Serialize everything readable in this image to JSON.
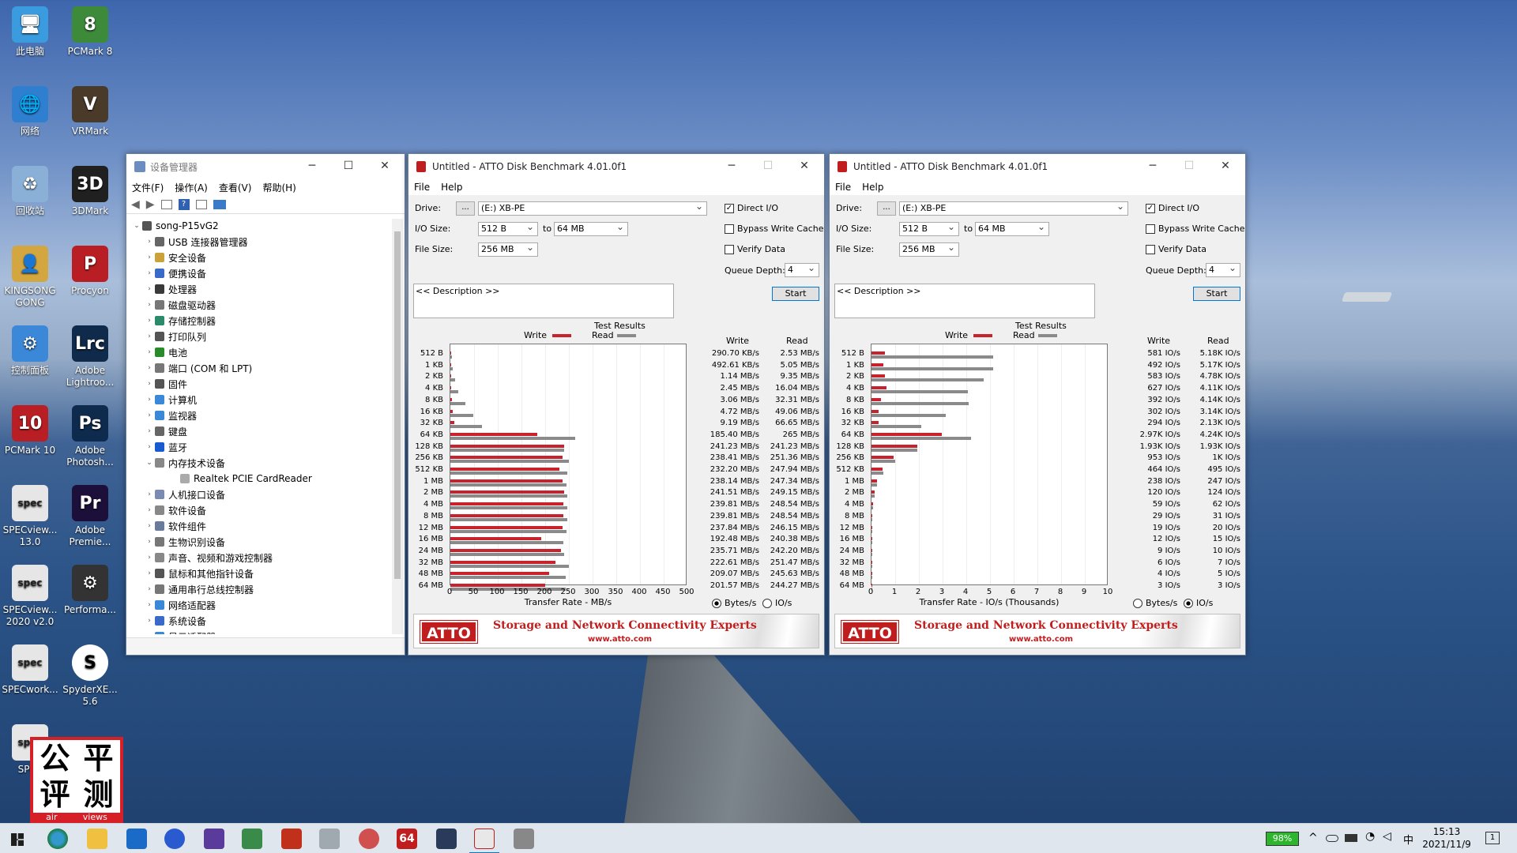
{
  "desktop": {
    "icons": [
      {
        "label": "此电脑",
        "color": "#3b9bdf",
        "glyph": "🖥"
      },
      {
        "label": "PCMark 8",
        "color": "#3c8a3a",
        "glyph": "8"
      },
      {
        "label": "网络",
        "color": "#2e7fd0",
        "glyph": "🌐"
      },
      {
        "label": "VRMark",
        "color": "#4a3a2a",
        "glyph": "V"
      },
      {
        "label": "回收站",
        "color": "#8ab0d8",
        "glyph": "♻"
      },
      {
        "label": "3DMark",
        "color": "#202020",
        "glyph": "3D"
      },
      {
        "label": "KINGSONG GONG",
        "color": "#d4a640",
        "glyph": "👤"
      },
      {
        "label": "Procyon",
        "color": "#b81e24",
        "glyph": "P"
      },
      {
        "label": "控制面板",
        "color": "#3b88d8",
        "glyph": "⚙"
      },
      {
        "label": "Adobe Lightroo...",
        "color": "#0f2a4a",
        "glyph": "Lrc"
      },
      {
        "label": "PCMark 10",
        "color": "#b81e24",
        "glyph": "10"
      },
      {
        "label": "Adobe Photosh...",
        "color": "#0e2a4d",
        "glyph": "Ps"
      },
      {
        "label": "SPECview... 13.0",
        "color": "#7a7a7a",
        "glyph": "spec"
      },
      {
        "label": "Adobe Premie...",
        "color": "#1c0f3a",
        "glyph": "Pr"
      },
      {
        "label": "SPECview... 2020 v2.0",
        "color": "#7a7a7a",
        "glyph": "spec"
      },
      {
        "label": "Performa...",
        "color": "#333333",
        "glyph": "⚙"
      },
      {
        "label": "SPECwork...",
        "color": "#7a7a7a",
        "glyph": "spec"
      },
      {
        "label": "SpyderXE... 5.6",
        "color": "#ffffff",
        "glyph": "S"
      },
      {
        "label": "SPEC",
        "color": "#7a7a7a",
        "glyph": "spec"
      }
    ],
    "watermark": {
      "chars": [
        "公",
        "平",
        "评",
        "测"
      ],
      "sub_left": "air",
      "sub_right": "views"
    }
  },
  "devmgr": {
    "title": "设备管理器",
    "menu": [
      "文件(F)",
      "操作(A)",
      "查看(V)",
      "帮助(H)"
    ],
    "root": "song-P15vG2",
    "items": [
      "USB 连接器管理器",
      "安全设备",
      "便携设备",
      "处理器",
      "磁盘驱动器",
      "存储控制器",
      "打印队列",
      "电池",
      "端口 (COM 和 LPT)",
      "固件",
      "计算机",
      "监视器",
      "键盘",
      "蓝牙",
      "内存技术设备",
      "Realtek PCIE CardReader",
      "人机接口设备",
      "软件设备",
      "软件组件",
      "生物识别设备",
      "声音、视频和游戏控制器",
      "鼠标和其他指针设备",
      "通用串行总线控制器",
      "网络适配器",
      "系统设备",
      "显示适配器"
    ]
  },
  "atto_common": {
    "menu_file": "File",
    "menu_help": "Help",
    "drive_label": "Drive:",
    "drive_btn": "...",
    "drive_value": "(E:) XB-PE",
    "io_label": "I/O Size:",
    "io_from": "512 B",
    "io_to_label": "to",
    "io_to": "64 MB",
    "file_label": "File Size:",
    "file_value": "256 MB",
    "direct_io": "Direct I/O",
    "bypass": "Bypass Write Cache",
    "verify": "Verify Data",
    "qd_label": "Queue Depth:",
    "qd_value": "4",
    "desc": "<< Description >>",
    "start": "Start",
    "results_title": "Test Results",
    "legend_write": "Write",
    "legend_read": "Read",
    "col_write": "Write",
    "col_read": "Read",
    "radio_bytes": "Bytes/s",
    "radio_io": "IO/s",
    "banner_logo": "ATTO",
    "banner_text": "Storage and Network Connectivity Experts",
    "banner_url": "www.atto.com",
    "sizes": [
      "512 B",
      "1 KB",
      "2 KB",
      "4 KB",
      "8 KB",
      "16 KB",
      "32 KB",
      "64 KB",
      "128 KB",
      "256 KB",
      "512 KB",
      "1 MB",
      "2 MB",
      "4 MB",
      "8 MB",
      "12 MB",
      "16 MB",
      "24 MB",
      "32 MB",
      "48 MB",
      "64 MB"
    ]
  },
  "atto1": {
    "title": "Untitled - ATTO Disk Benchmark 4.01.0f1",
    "xlabel": "Transfer Rate - MB/s",
    "ticks": [
      "0",
      "50",
      "100",
      "150",
      "200",
      "250",
      "300",
      "350",
      "400",
      "450",
      "500"
    ],
    "max": 500,
    "unit_selected": "bytes",
    "write_vals": [
      "290.70 KB/s",
      "492.61 KB/s",
      "1.14 MB/s",
      "2.45 MB/s",
      "3.06 MB/s",
      "4.72 MB/s",
      "9.19 MB/s",
      "185.40 MB/s",
      "241.23 MB/s",
      "238.41 MB/s",
      "232.20 MB/s",
      "238.14 MB/s",
      "241.51 MB/s",
      "239.81 MB/s",
      "239.81 MB/s",
      "237.84 MB/s",
      "192.48 MB/s",
      "235.71 MB/s",
      "222.61 MB/s",
      "209.07 MB/s",
      "201.57 MB/s"
    ],
    "read_vals": [
      "2.53 MB/s",
      "5.05 MB/s",
      "9.35 MB/s",
      "16.04 MB/s",
      "32.31 MB/s",
      "49.06 MB/s",
      "66.65 MB/s",
      "265 MB/s",
      "241.23 MB/s",
      "251.36 MB/s",
      "247.94 MB/s",
      "247.34 MB/s",
      "249.15 MB/s",
      "248.54 MB/s",
      "248.54 MB/s",
      "246.15 MB/s",
      "240.38 MB/s",
      "242.20 MB/s",
      "251.47 MB/s",
      "245.63 MB/s",
      "244.27 MB/s"
    ],
    "write": [
      0.28,
      0.48,
      1.14,
      2.45,
      3.06,
      4.72,
      9.19,
      185.4,
      241.23,
      238.41,
      232.2,
      238.14,
      241.51,
      239.81,
      239.81,
      237.84,
      192.48,
      235.71,
      222.61,
      209.07,
      201.57
    ],
    "read": [
      2.53,
      5.05,
      9.35,
      16.04,
      32.31,
      49.06,
      66.65,
      265,
      241.23,
      251.36,
      247.94,
      247.34,
      249.15,
      248.54,
      248.54,
      246.15,
      240.38,
      242.2,
      251.47,
      245.63,
      244.27
    ]
  },
  "atto2": {
    "title": "Untitled - ATTO Disk Benchmark 4.01.0f1",
    "xlabel": "Transfer Rate - IO/s (Thousands)",
    "ticks": [
      "0",
      "1",
      "2",
      "3",
      "4",
      "5",
      "6",
      "7",
      "8",
      "9",
      "10"
    ],
    "max": 10,
    "unit_selected": "io",
    "write_vals": [
      "581 IO/s",
      "492 IO/s",
      "583 IO/s",
      "627 IO/s",
      "392 IO/s",
      "302 IO/s",
      "294 IO/s",
      "2.97K IO/s",
      "1.93K IO/s",
      "953 IO/s",
      "464 IO/s",
      "238 IO/s",
      "120 IO/s",
      "59 IO/s",
      "29 IO/s",
      "19 IO/s",
      "12 IO/s",
      "9 IO/s",
      "6 IO/s",
      "4 IO/s",
      "3 IO/s"
    ],
    "read_vals": [
      "5.18K IO/s",
      "5.17K IO/s",
      "4.78K IO/s",
      "4.11K IO/s",
      "4.14K IO/s",
      "3.14K IO/s",
      "2.13K IO/s",
      "4.24K IO/s",
      "1.93K IO/s",
      "1K IO/s",
      "495 IO/s",
      "247 IO/s",
      "124 IO/s",
      "62 IO/s",
      "31 IO/s",
      "20 IO/s",
      "15 IO/s",
      "10 IO/s",
      "7 IO/s",
      "5 IO/s",
      "3 IO/s"
    ],
    "write": [
      0.581,
      0.492,
      0.583,
      0.627,
      0.392,
      0.302,
      0.294,
      2.97,
      1.93,
      0.953,
      0.464,
      0.238,
      0.12,
      0.059,
      0.029,
      0.019,
      0.012,
      0.009,
      0.006,
      0.004,
      0.003
    ],
    "read": [
      5.18,
      5.17,
      4.78,
      4.11,
      4.14,
      3.14,
      2.13,
      4.24,
      1.93,
      1.0,
      0.495,
      0.247,
      0.124,
      0.062,
      0.031,
      0.02,
      0.015,
      0.01,
      0.007,
      0.005,
      0.003
    ]
  },
  "taskbar": {
    "battery": "98%",
    "ime": "中",
    "time": "15:13",
    "date": "2021/11/9",
    "notif": "1",
    "tray_up": "^"
  }
}
